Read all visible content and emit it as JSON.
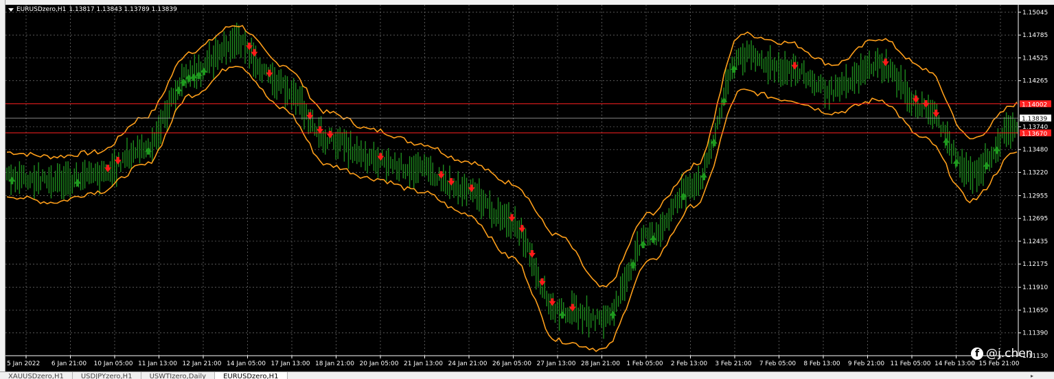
{
  "window": {
    "symbol": "EURUSDzero,H1",
    "ohlc": "1.13817 1.13843 1.13789 1.13839"
  },
  "colors": {
    "background": "#000000",
    "grid": "#7a7a7a",
    "band": "#ff9f1a",
    "candles": "#1e8c1e",
    "buy_arrow": "#1f9b1f",
    "sell_arrow": "#ff1a1a",
    "level_line": "#ff2020",
    "price_line": "#b0b0b0",
    "axis_text": "#ffffff"
  },
  "price_axis": {
    "ticks": [
      "1.15045",
      "1.14785",
      "1.14525",
      "1.14265",
      "1.13740",
      "1.13480",
      "1.13220",
      "1.12955",
      "1.12695",
      "1.12435",
      "1.12175",
      "1.11910",
      "1.11650",
      "1.11390",
      "1.11130"
    ],
    "tick_values": [
      1.15045,
      1.14785,
      1.14525,
      1.14265,
      1.1374,
      1.1348,
      1.1322,
      1.12955,
      1.12695,
      1.12435,
      1.12175,
      1.1191,
      1.1165,
      1.1139,
      1.1113
    ],
    "range": [
      1.1113,
      1.1513
    ],
    "current_price": "1.13839",
    "current_value": 1.13839,
    "levels": [
      {
        "label": "1.14002",
        "value": 1.14002
      },
      {
        "label": "1.13670",
        "value": 1.1367
      }
    ]
  },
  "time_axis": {
    "labels": [
      "5 Jan 2022",
      "6 Jan 21:00",
      "10 Jan 05:00",
      "11 Jan 13:00",
      "12 Jan 21:00",
      "14 Jan 05:00",
      "17 Jan 13:00",
      "18 Jan 21:00",
      "20 Jan 05:00",
      "21 Jan 13:00",
      "24 Jan 21:00",
      "26 Jan 05:00",
      "27 Jan 13:00",
      "28 Jan 21:00",
      "1 Feb 05:00",
      "2 Feb 13:00",
      "3 Feb 21:00",
      "7 Feb 05:00",
      "8 Feb 13:00",
      "9 Feb 21:00",
      "11 Feb 05:00",
      "14 Feb 13:00",
      "15 Feb 21:00"
    ]
  },
  "chart_data": {
    "type": "line",
    "x": [
      "5 Jan 2022",
      "6 Jan 21:00",
      "10 Jan 05:00",
      "11 Jan 13:00",
      "12 Jan 21:00",
      "14 Jan 05:00",
      "17 Jan 13:00",
      "18 Jan 21:00",
      "20 Jan 05:00",
      "21 Jan 13:00",
      "24 Jan 21:00",
      "26 Jan 05:00",
      "27 Jan 13:00",
      "28 Jan 21:00",
      "1 Feb 05:00",
      "2 Feb 13:00",
      "3 Feb 21:00",
      "7 Feb 05:00",
      "8 Feb 13:00",
      "9 Feb 21:00",
      "11 Feb 05:00",
      "14 Feb 13:00",
      "15 Feb 21:00"
    ],
    "ylim": [
      1.1113,
      1.1513
    ],
    "series": [
      {
        "values": [
          1.1318,
          1.1312,
          1.1318,
          1.135,
          1.1435,
          1.147,
          1.142,
          1.136,
          1.1335,
          1.1325,
          1.13,
          1.1265,
          1.1165,
          1.1155,
          1.125,
          1.131,
          1.1455,
          1.144,
          1.1415,
          1.1445,
          1.1395,
          1.132,
          1.1375
        ]
      },
      {
        "values": [
          1.1345,
          1.134,
          1.1345,
          1.1385,
          1.146,
          1.149,
          1.1445,
          1.139,
          1.137,
          1.1355,
          1.1335,
          1.131,
          1.125,
          1.119,
          1.1275,
          1.133,
          1.148,
          1.147,
          1.1445,
          1.1475,
          1.144,
          1.136,
          1.14
        ]
      },
      {
        "values": [
          1.1295,
          1.1288,
          1.13,
          1.133,
          1.141,
          1.1445,
          1.1395,
          1.133,
          1.1315,
          1.13,
          1.1275,
          1.1225,
          1.113,
          1.112,
          1.122,
          1.1285,
          1.1415,
          1.1405,
          1.139,
          1.1405,
          1.136,
          1.129,
          1.1345
        ]
      }
    ],
    "grid": true
  }
}
